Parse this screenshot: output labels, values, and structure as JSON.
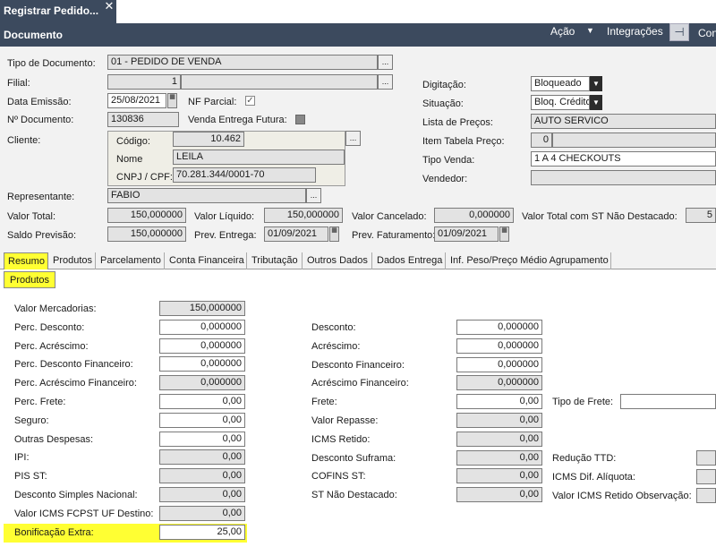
{
  "window": {
    "tab_title": "Registrar Pedido...",
    "close_glyph": "✕",
    "header_title": "Documento",
    "menu": {
      "acao": "Ação",
      "acao_arrow": "▼",
      "integracoes": "Integrações",
      "pin_glyph": "⊣",
      "cont": "Con"
    }
  },
  "form": {
    "tipo_documento": {
      "label": "Tipo de Documento:",
      "value": "01 - PEDIDO DE VENDA"
    },
    "filial": {
      "label": "Filial:",
      "value": "1"
    },
    "data_emissao": {
      "label": "Data Emissão:",
      "value": "25/08/2021"
    },
    "nf_parcial": {
      "label": "NF Parcial:",
      "checked_glyph": "✓"
    },
    "n_documento": {
      "label": "Nº Documento:",
      "value": "130836"
    },
    "venda_entrega_futura": {
      "label": "Venda Entrega Futura:"
    },
    "cliente": {
      "label": "Cliente:",
      "codigo_label": "Código:",
      "codigo": "10.462",
      "nome_label": "Nome",
      "nome": "LEILA",
      "cnpj_label": "CNPJ / CPF:",
      "cnpj": "70.281.344/0001-70"
    },
    "digitacao": {
      "label": "Digitação:",
      "value": "Bloqueado"
    },
    "situacao": {
      "label": "Situação:",
      "value": "Bloq. Crédito"
    },
    "lista_precos": {
      "label": "Lista de Preços:",
      "value": "AUTO SERVICO"
    },
    "item_tabela_preco": {
      "label": "Item Tabela Preço:",
      "value": "0"
    },
    "tipo_venda": {
      "label": "Tipo Venda:",
      "value": "1 A 4 CHECKOUTS"
    },
    "vendedor": {
      "label": "Vendedor:",
      "value": ""
    },
    "representante": {
      "label": "Representante:",
      "value": "FABIO"
    },
    "valor_total": {
      "label": "Valor Total:",
      "value": "150,000000"
    },
    "valor_liquido": {
      "label": "Valor Líquido:",
      "value": "150,000000"
    },
    "valor_cancelado": {
      "label": "Valor Cancelado:",
      "value": "0,000000"
    },
    "valor_total_st": {
      "label": "Valor Total com ST Não Destacado:",
      "value": "5"
    },
    "saldo_previsao": {
      "label": "Saldo Previsão:",
      "value": "150,000000"
    },
    "prev_entrega": {
      "label": "Prev. Entrega:",
      "value": "01/09/2021"
    },
    "prev_faturamento": {
      "label": "Prev. Faturamento:",
      "value": "01/09/2021"
    },
    "lookup_glyph": "...",
    "dropdown_glyph": "▼",
    "calendar_glyph": "▦"
  },
  "tabs": [
    "Resumo",
    "Produtos",
    "Parcelamento",
    "Conta Financeira",
    "Tributação",
    "Outros Dados",
    "Dados Entrega",
    "Inf. Peso/Preço Médio Agrupamento"
  ],
  "section_tab": "Produtos",
  "resumo": {
    "left": [
      {
        "label": "Valor Mercadorias:",
        "value": "150,000000"
      },
      {
        "label": "Perc. Desconto:",
        "value": "0,000000"
      },
      {
        "label": "Perc. Acréscimo:",
        "value": "0,000000"
      },
      {
        "label": "Perc. Desconto Financeiro:",
        "value": "0,000000"
      },
      {
        "label": "Perc. Acréscimo Financeiro:",
        "value": "0,000000"
      },
      {
        "label": "Perc. Frete:",
        "value": "0,00"
      },
      {
        "label": "Seguro:",
        "value": "0,00"
      },
      {
        "label": "Outras Despesas:",
        "value": "0,00"
      },
      {
        "label": "IPI:",
        "value": "0,00"
      },
      {
        "label": "PIS ST:",
        "value": "0,00"
      },
      {
        "label": "Desconto Simples Nacional:",
        "value": "0,00"
      },
      {
        "label": "Valor ICMS FCPST UF Destino:",
        "value": "0,00"
      },
      {
        "label": "Bonificação Extra:",
        "value": "25,00"
      }
    ],
    "middle": [
      {
        "label": "Desconto:",
        "value": "0,000000"
      },
      {
        "label": "Acréscimo:",
        "value": "0,000000"
      },
      {
        "label": "Desconto Financeiro:",
        "value": "0,000000"
      },
      {
        "label": "Acréscimo Financeiro:",
        "value": "0,000000"
      },
      {
        "label": "Frete:",
        "value": "0,00"
      },
      {
        "label": "Valor Repasse:",
        "value": "0,00"
      },
      {
        "label": "ICMS Retido:",
        "value": "0,00"
      },
      {
        "label": "Desconto Suframa:",
        "value": "0,00"
      },
      {
        "label": "COFINS ST:",
        "value": "0,00"
      },
      {
        "label": "ST Não Destacado:",
        "value": "0,00"
      }
    ],
    "right": [
      {
        "label": "Tipo de Frete:",
        "value": ""
      },
      {
        "label": "Redução TTD:",
        "value": ""
      },
      {
        "label": "ICMS Dif. Alíquota:",
        "value": ""
      },
      {
        "label": "Valor ICMS Retido Observação:",
        "value": ""
      }
    ]
  },
  "colors": {
    "header_bg": "#3c4a5e",
    "highlight": "#ffff33",
    "readonly_field": "#e3e3e3"
  }
}
